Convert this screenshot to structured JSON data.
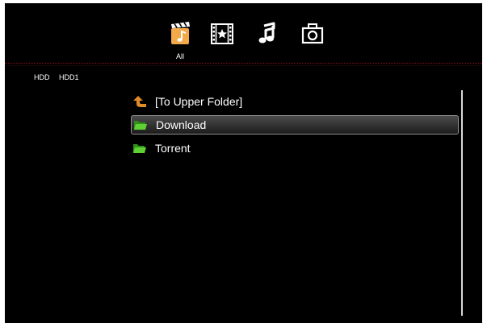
{
  "media_tabs": [
    {
      "name": "all",
      "icon": "clapper-music-icon",
      "label": "All",
      "active": true
    },
    {
      "name": "movies",
      "icon": "film-star-icon",
      "active": false
    },
    {
      "name": "music",
      "icon": "music-note-icon",
      "active": false
    },
    {
      "name": "photos",
      "icon": "camera-icon",
      "active": false
    }
  ],
  "active_tab_label": "All",
  "breadcrumb": [
    "HDD",
    "HDD1"
  ],
  "file_list": [
    {
      "label": "[To Upper Folder]",
      "icon": "up-arrow-icon",
      "selected": false
    },
    {
      "label": "Download",
      "icon": "folder-icon",
      "selected": true
    },
    {
      "label": "Torrent",
      "icon": "folder-icon",
      "selected": false
    }
  ],
  "colors": {
    "background": "#000000",
    "active_tab": "#f0a040",
    "divider": "#8a0f12",
    "folder": "#4fbf2a",
    "up_arrow": "#e08a2a"
  }
}
